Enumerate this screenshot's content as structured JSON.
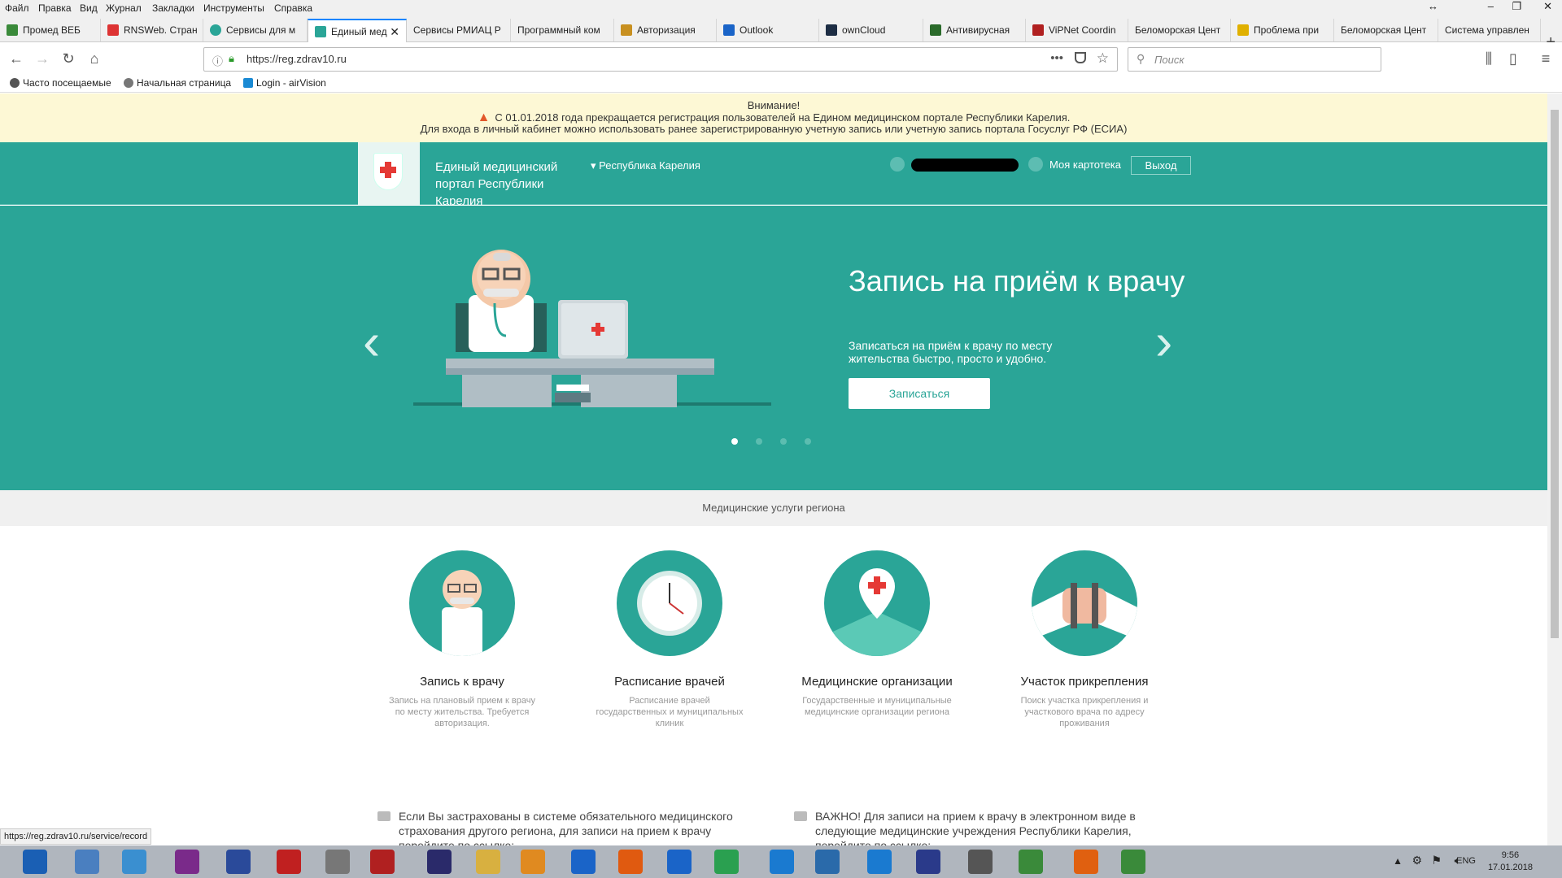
{
  "menubar": {
    "items": [
      "Файл",
      "Правка",
      "Вид",
      "Журнал",
      "Закладки",
      "Инструменты",
      "Справка"
    ]
  },
  "tabs": [
    {
      "label": "Промед ВЕБ",
      "color": "#3a8a3a"
    },
    {
      "label": "RNSWeb. Стран",
      "color": "#d33"
    },
    {
      "label": "Сервисы для м",
      "color": "#2aa597"
    },
    {
      "label": "Единый мед",
      "color": "#2aa597",
      "active": true
    },
    {
      "label": "Сервисы РМИАЦ Р",
      "color": "#fff"
    },
    {
      "label": "Программный ком",
      "color": "#fff"
    },
    {
      "label": "Авторизация",
      "color": "#c89020"
    },
    {
      "label": "Outlook",
      "color": "#1a64c8"
    },
    {
      "label": "ownCloud",
      "color": "#1d2d44"
    },
    {
      "label": "Антивирусная",
      "color": "#2a6a2a"
    },
    {
      "label": "ViPNet Coordin",
      "color": "#b02020"
    },
    {
      "label": "Беломорская Цент",
      "color": "#fff"
    },
    {
      "label": "Проблема при",
      "color": "#e0b000"
    },
    {
      "label": "Беломорская Цент",
      "color": "#fff"
    },
    {
      "label": "Система управлен",
      "color": "#fff"
    }
  ],
  "nav": {
    "url": "https://reg.zdrav10.ru",
    "search_placeholder": "Поиск"
  },
  "bookmarks": [
    {
      "label": "Часто посещаемые",
      "color": "#555"
    },
    {
      "label": "Начальная страница",
      "color": "#777"
    },
    {
      "label": "Login - airVision",
      "color": "#1a8ad4"
    }
  ],
  "alert": {
    "title": "Внимание!",
    "line1": "С 01.01.2018 года прекращается регистрация пользователей на Едином медицинском портале Республики Карелия.",
    "line2": "Для входа в личный кабинет можно использовать ранее зарегистрированную учетную запись или учетную запись портала Госуслуг РФ (ЕСИА)"
  },
  "header": {
    "portal_title": "Единый медицинский портал Республики Карелия",
    "region": "Республика Карелия",
    "my_card": "Моя картотека",
    "logout": "Выход"
  },
  "hero": {
    "title": "Запись на приём к врачу",
    "subtitle": "Записаться на приём к врачу по месту жительства быстро, просто и удобно.",
    "button": "Записаться",
    "active_slide": 1,
    "slide_count": 4
  },
  "services": {
    "heading": "Медицинские услуги региона",
    "items": [
      {
        "name": "Запись к врачу",
        "desc": "Запись на плановый прием к врачу по месту жительства. Требуется авторизация."
      },
      {
        "name": "Расписание врачей",
        "desc": "Расписание врачей государственных и муниципальных клиник"
      },
      {
        "name": "Медицинские организации",
        "desc": "Государственные и муниципальные медицинские организации региона"
      },
      {
        "name": "Участок прикрепления",
        "desc": "Поиск участка прикрепления и участкового врача по адресу проживания"
      }
    ]
  },
  "notes": [
    "Если Вы застрахованы в системе обязательного медицинского страхования другого региона, для записи на прием к врачу перейдите по ссылке:",
    "ВАЖНО! Для записи на прием к врачу в электронном виде в следующие медицинские учреждения Республики Карелия, перейдите по ссылке:"
  ],
  "status_url": "https://reg.zdrav10.ru/service/record",
  "taskbar": {
    "lang": "ENG",
    "time": "9:56",
    "date": "17.01.2018",
    "icons": [
      "#1a5fb4",
      "#4a7fc0",
      "#3a8fd0",
      "#7a2a8a",
      "#2a4a9a",
      "#c02020",
      "#777",
      "#b02020",
      "#2a2a6a",
      "#d8b040",
      "#e08a20",
      "#1a64c8",
      "#e05a10",
      "#1a64c8",
      "#2aa050",
      "#1a7ad0",
      "#2a6aaa",
      "#1a7ad0",
      "#2a3a8a",
      "#555",
      "#3a8a3a",
      "#e06010",
      "#3a8a3a"
    ]
  }
}
